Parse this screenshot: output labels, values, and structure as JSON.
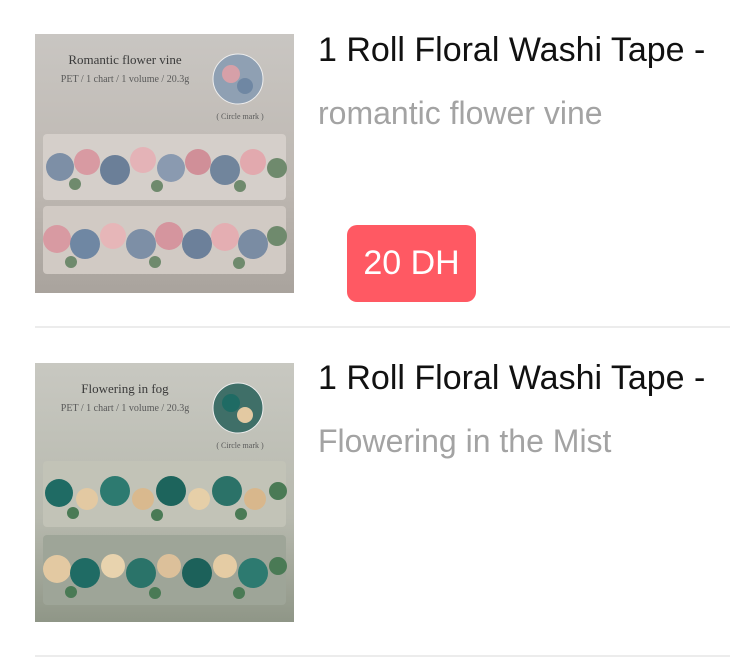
{
  "products": [
    {
      "title": "1 Roll Floral Washi Tape -",
      "subtitle": "romantic flower vine",
      "price": "20 DH",
      "image": {
        "heading": "Romantic flower vine",
        "meta": "PET / 1 chart / 1 volume / 20.3g",
        "mark": "( Circle mark )",
        "palette": [
          "#7d8fa6",
          "#d89aa2",
          "#6f8a6d"
        ]
      }
    },
    {
      "title": "1 Roll Floral Washi Tape -",
      "subtitle": "Flowering in the Mist",
      "image": {
        "heading": "Flowering in fog",
        "meta": "PET / 1 chart / 1 volume / 20.3g",
        "mark": "( Circle mark )",
        "palette": [
          "#1f6b64",
          "#e3c9a2",
          "#4a7a55"
        ]
      }
    }
  ]
}
